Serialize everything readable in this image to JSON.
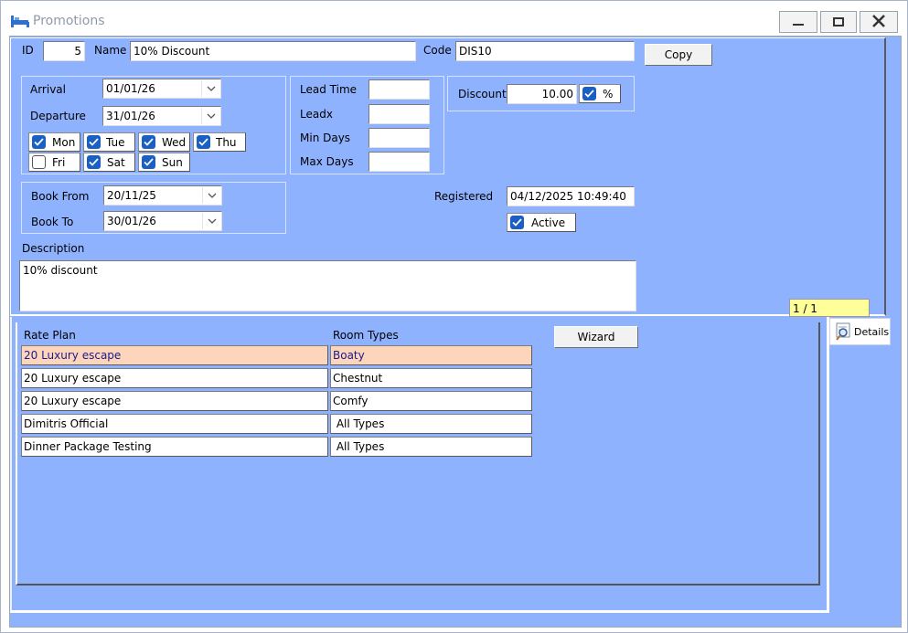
{
  "window": {
    "title": "Promotions"
  },
  "form": {
    "id_label": "ID",
    "id_value": "5",
    "name_label": "Name",
    "name_value": "10% Discount",
    "code_label": "Code",
    "code_value": "DIS10",
    "copy_label": "Copy",
    "arrival_label": "Arrival",
    "arrival_value": "01/01/26",
    "departure_label": "Departure",
    "departure_value": "31/01/26",
    "days": [
      {
        "label": "Mon",
        "checked": true
      },
      {
        "label": "Tue",
        "checked": true
      },
      {
        "label": "Wed",
        "checked": true
      },
      {
        "label": "Thu",
        "checked": true
      },
      {
        "label": "Fri",
        "checked": false
      },
      {
        "label": "Sat",
        "checked": true
      },
      {
        "label": "Sun",
        "checked": true
      }
    ],
    "lead_time_label": "Lead Time",
    "lead_time_value": "",
    "leadx_label": "Leadx",
    "leadx_value": "",
    "min_days_label": "Min Days",
    "min_days_value": "",
    "max_days_label": "Max Days",
    "max_days_value": "",
    "discount_label": "Discount",
    "discount_value": "10.00",
    "percent_label": "%",
    "percent_checked": true,
    "book_from_label": "Book From",
    "book_from_value": "20/11/25",
    "book_to_label": "Book To",
    "book_to_value": "30/01/26",
    "registered_label": "Registered",
    "registered_value": "04/12/2025 10:49:40",
    "active_label": "Active",
    "active_checked": true,
    "description_label": "Description",
    "description_value": "10% discount",
    "record_counter": "1 / 1"
  },
  "details_label": "Details",
  "grid": {
    "col_rate_plan": "Rate Plan",
    "col_room_types": "Room Types",
    "wizard_label": "Wizard",
    "rows": [
      {
        "rate_plan": "20 Luxury escape",
        "room_type": "Boaty"
      },
      {
        "rate_plan": "20 Luxury escape",
        "room_type": "Chestnut"
      },
      {
        "rate_plan": "20 Luxury escape",
        "room_type": "Comfy"
      },
      {
        "rate_plan": "Dimitris Official",
        "room_type": " All Types"
      },
      {
        "rate_plan": "Dinner Package Testing",
        "room_type": " All Types"
      }
    ]
  },
  "colors": {
    "background": "#8fb2ff",
    "selected_row": "#fdd5bb",
    "counter": "#ffff99",
    "check": "#1a5fc4"
  }
}
